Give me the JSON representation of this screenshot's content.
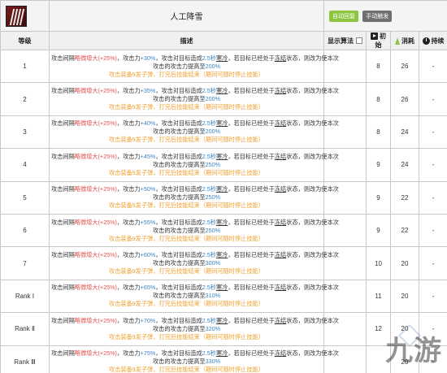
{
  "header": {
    "skill_name": "人工降雪",
    "tags": [
      {
        "label": "自动回复",
        "color": "#8cc63f"
      },
      {
        "label": "手动触发",
        "color": "#6f6f6f"
      }
    ]
  },
  "columns": {
    "level": "等级",
    "description": "描述",
    "show_formula": "显示算法",
    "initial": "初始",
    "cost": "消耗",
    "duration": "持续"
  },
  "rows": [
    {
      "level": "1",
      "atk": "+30%",
      "hit": "200%",
      "initial": "8",
      "cost": "26",
      "duration": "-"
    },
    {
      "level": "2",
      "atk": "+35%",
      "hit": "200%",
      "initial": "8",
      "cost": "26",
      "duration": "-"
    },
    {
      "level": "3",
      "atk": "+40%",
      "hit": "200%",
      "initial": "8",
      "cost": "24",
      "duration": "-"
    },
    {
      "level": "4",
      "atk": "+45%",
      "hit": "250%",
      "initial": "9",
      "cost": "24",
      "duration": "-"
    },
    {
      "level": "5",
      "atk": "+50%",
      "hit": "250%",
      "initial": "9",
      "cost": "22",
      "duration": "-"
    },
    {
      "level": "6",
      "atk": "+55%",
      "hit": "250%",
      "initial": "9",
      "cost": "22",
      "duration": "-"
    },
    {
      "level": "7",
      "atk": "+60%",
      "hit": "300%",
      "initial": "10",
      "cost": "20",
      "duration": "-"
    },
    {
      "level": "Rank Ⅰ",
      "atk": "+65%",
      "hit": "310%",
      "initial": "11",
      "cost": "20",
      "duration": "-"
    },
    {
      "level": "Rank Ⅱ",
      "atk": "+70%",
      "hit": "320%",
      "initial": "12",
      "cost": "20",
      "duration": "-"
    },
    {
      "level": "Rank Ⅲ",
      "atk": "+75%",
      "hit": "330%",
      "initial": "",
      "cost": "20",
      "duration": "-"
    }
  ],
  "desc_text": {
    "p1": "攻击间隔",
    "interval": "略微增大(+25%)",
    "p2": "，攻击力",
    "p3": "，攻击对目标造成",
    "sec": "2.5秒",
    "cold": "寒冷",
    "p4": "，若目标已经处于",
    "frozen": "冻结",
    "p5": "状态，则改为使本次",
    "p6": "攻击的攻击力提高至",
    "line3": "攻击装备9发子弹，打完后技能结束（期间可随时停止技能）"
  },
  "watermark": "九游",
  "colors": {
    "red": "#e05151",
    "blue": "#3b84c4",
    "orange": "#f0a030",
    "tag_green": "#8cc63f",
    "tag_gray": "#6f6f6f"
  },
  "icons": {
    "skill": "skill-icon",
    "initial": "play-icon",
    "cost": "energy-icon",
    "duration": "clock-icon"
  }
}
